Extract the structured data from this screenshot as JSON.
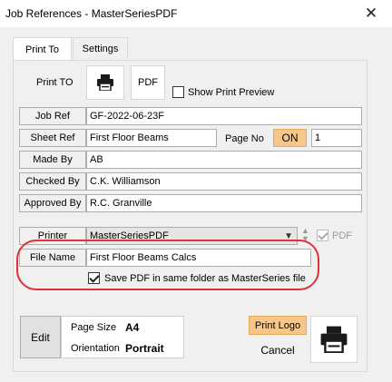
{
  "window": {
    "title": "Job References - MasterSeriesPDF",
    "close_glyph": "✕"
  },
  "tabs": [
    {
      "label": "Print To"
    },
    {
      "label": "Settings"
    }
  ],
  "print_to": {
    "label": "Print TO",
    "printer_icon": "printer-icon",
    "pdf_label": "PDF",
    "show_preview_label": "Show Print Preview",
    "show_preview_checked": false
  },
  "fields": {
    "job_ref": {
      "label": "Job Ref",
      "value": "GF-2022-06-23F"
    },
    "sheet_ref": {
      "label": "Sheet Ref",
      "value": "First Floor Beams"
    },
    "page_no": {
      "label": "Page No",
      "toggle": "ON",
      "value": "1"
    },
    "made_by": {
      "label": "Made By",
      "value": "AB"
    },
    "checked_by": {
      "label": "Checked By",
      "value": "C.K. Williamson"
    },
    "approved_by": {
      "label": "Approved By",
      "value": "R.C. Granville"
    }
  },
  "printer": {
    "label": "Printer",
    "selected": "MasterSeriesPDF",
    "pdf_checkbox_label": "PDF",
    "pdf_checked": true
  },
  "file": {
    "label": "File Name",
    "value": "First Floor Beams Calcs",
    "save_same_folder_label": "Save PDF in same folder as MasterSeries file",
    "save_same_folder_checked": true
  },
  "page_setup": {
    "edit_label": "Edit",
    "page_size_label": "Page Size",
    "page_size_value": "A4",
    "orientation_label": "Orientation",
    "orientation_value": "Portrait"
  },
  "actions": {
    "print_logo_label": "Print Logo",
    "cancel_label": "Cancel"
  },
  "colors": {
    "accent_orange": "#f7c68a",
    "highlight_red": "#e0303a"
  }
}
